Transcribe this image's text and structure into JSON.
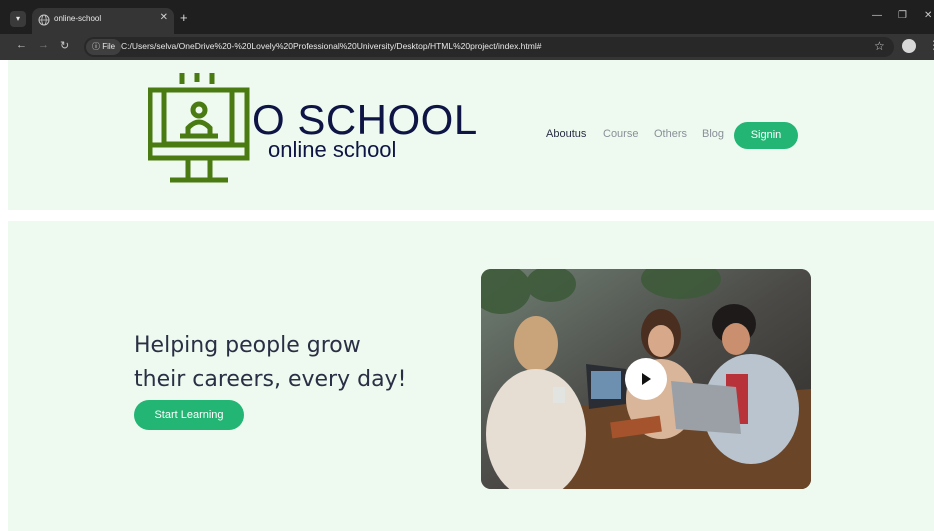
{
  "browser": {
    "tab_title": "online-school",
    "url": "C:/Users/selva/OneDrive%20-%20Lovely%20Professional%20University/Desktop/HTML%20project/index.html#",
    "file_chip": "ⓘ File"
  },
  "logo": {
    "title": "O SCHOOL",
    "subtitle": "online school",
    "icon": "monitor-teacher-icon"
  },
  "nav": {
    "items": [
      {
        "label": "Aboutus",
        "color": "#2b2f45"
      },
      {
        "label": "Course",
        "color": "#8a8f99"
      },
      {
        "label": "Others",
        "color": "#8a8f99"
      },
      {
        "label": "Blog",
        "color": "#8a8f99"
      }
    ],
    "signin_label": "Signin"
  },
  "hero": {
    "headline_line1": "Helping people grow",
    "headline_line2": "their careers, every day!",
    "cta_label": "Start Learning",
    "media": {
      "icon": "play-icon"
    }
  },
  "colors": {
    "accent": "#22b573",
    "header_bg": "#eefaef",
    "logo_green": "#4a7a12",
    "logo_navy": "#0e1545"
  }
}
